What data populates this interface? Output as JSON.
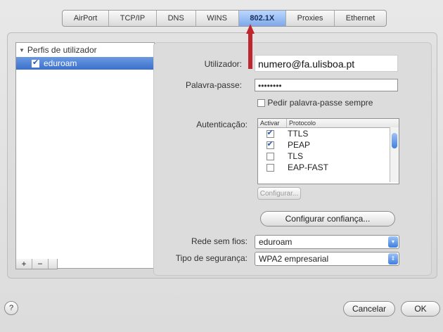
{
  "tabs": [
    {
      "label": "AirPort"
    },
    {
      "label": "TCP/IP"
    },
    {
      "label": "DNS"
    },
    {
      "label": "WINS"
    },
    {
      "label": "802.1X",
      "active": true
    },
    {
      "label": "Proxies"
    },
    {
      "label": "Ethernet"
    }
  ],
  "profiles": {
    "header": "Perfis de utilizador",
    "items": [
      {
        "label": "eduroam",
        "checked": true
      }
    ],
    "add_label": "+",
    "remove_label": "−"
  },
  "form": {
    "user_label": "Utilizador:",
    "user_value": "numero@fa.ulisboa.pt",
    "password_label": "Palavra-passe:",
    "password_value": "••••••••",
    "ask_password_label": "Pedir palavra-passe sempre",
    "ask_password_checked": false,
    "auth_label": "Autenticação:",
    "auth_columns": [
      "Activar",
      "Protocolo"
    ],
    "auth_rows": [
      {
        "enabled": true,
        "protocol": "TTLS"
      },
      {
        "enabled": true,
        "protocol": "PEAP"
      },
      {
        "enabled": false,
        "protocol": "TLS"
      },
      {
        "enabled": false,
        "protocol": "EAP-FAST"
      }
    ],
    "configure_label": "Configurar...",
    "trust_label": "Configurar confiança...",
    "network_label": "Rede sem fios:",
    "network_value": "eduroam",
    "security_label": "Tipo de segurança:",
    "security_value": "WPA2 empresarial"
  },
  "footer": {
    "help_label": "?",
    "cancel_label": "Cancelar",
    "ok_label": "OK"
  },
  "colors": {
    "selection": "#3c6fcd",
    "arrow": "#c0262d",
    "tab_active": "#7ea9ea"
  }
}
